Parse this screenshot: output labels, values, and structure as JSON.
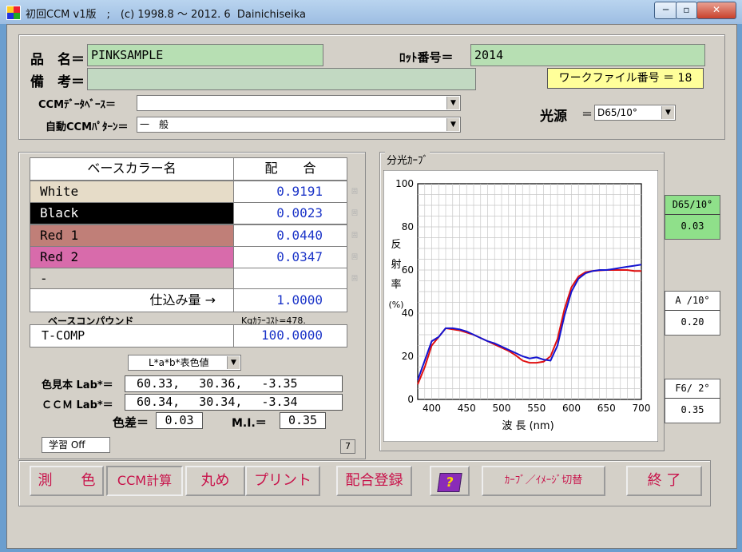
{
  "window": {
    "title": "初回CCM v1版　;　(c) 1998.8 ～ 2012. 6  Dainichiseika",
    "minimize": "─",
    "restore": "▫",
    "close": "✕"
  },
  "header": {
    "product_name_label": "品　名＝",
    "product_name_value": "PINKSAMPLE",
    "lot_label": "ﾛｯﾄ番号＝",
    "lot_value": "2014",
    "remarks_label": "備　考＝",
    "remarks_value": "",
    "workfile_label": "ワークファイル番号 ＝ 18",
    "ccm_db_label": "CCMﾃﾞｰﾀﾍﾞｰｽ＝",
    "ccm_db_value": "",
    "auto_pattern_label": "自動CCMﾊﾟﾀｰﾝ＝",
    "auto_pattern_value": "一　般",
    "light_source_label": "光源",
    "light_source_eq": "＝",
    "light_source_value": "D65/10°"
  },
  "recipe": {
    "col_base": "ベースカラー名",
    "col_ratio": "配　　合",
    "rows": [
      {
        "name": "White",
        "ratio": "0.9191",
        "bg": "#e6dcc8",
        "fg": "#000000"
      },
      {
        "name": "Black",
        "ratio": "0.0023",
        "bg": "#000000",
        "fg": "#ffffff"
      },
      {
        "name": "Red 1",
        "ratio": "0.0440",
        "bg": "#c07f78",
        "fg": "#000000"
      },
      {
        "name": "Red 2",
        "ratio": "0.0347",
        "bg": "#d86bab",
        "fg": "#000000"
      },
      {
        "name": "-",
        "ratio": "",
        "bg": "#d4d0c8",
        "fg": "#000000"
      }
    ],
    "lock_glyph": "固",
    "charge_label": "仕込み量 →",
    "charge_value": "1.0000",
    "base_compound_label": "ベースコンパウンド",
    "cost_label": "Kgｶﾗｰｺｽﾄ=478.",
    "compound_name": "T-COMP",
    "compound_value": "100.0000",
    "color_space_value": "L*a*b*表色値",
    "sample_label": "色見本 Lab*＝",
    "sample_value": "60.33,　 30.36,　 -3.35",
    "ccm_label": "ＣＣＭ Lab*＝",
    "ccm_value": "60.34,　 30.34,　 -3.34",
    "delta_label": "色差＝",
    "delta_value": "0.03",
    "mi_label": "M.I.＝",
    "mi_value": "0.35",
    "learning_label": "学習 Off",
    "page_no": "7"
  },
  "chart_panel_title": "分光ｶｰﾌﾞ",
  "chart_data": {
    "type": "line",
    "title": "",
    "xlabel": "波 長 (nm)",
    "ylabel": "反射率(%)",
    "ylabel_chars": [
      "反",
      "射",
      "率",
      "(%)"
    ],
    "xlim": [
      380,
      700
    ],
    "ylim": [
      0,
      100
    ],
    "xticks": [
      400,
      450,
      500,
      550,
      600,
      650,
      700
    ],
    "yticks": [
      0,
      20,
      40,
      60,
      80,
      100
    ],
    "grid": true,
    "series": [
      {
        "color": "#e01010",
        "x": [
          380,
          390,
          400,
          410,
          420,
          430,
          440,
          450,
          460,
          470,
          480,
          490,
          500,
          510,
          520,
          530,
          540,
          550,
          560,
          570,
          580,
          590,
          600,
          610,
          620,
          630,
          640,
          650,
          660,
          670,
          680,
          690,
          700
        ],
        "values": [
          7,
          15,
          25,
          29,
          33,
          32.5,
          32,
          31,
          30,
          28.5,
          27,
          25.5,
          24,
          22.5,
          20.5,
          18,
          17,
          17,
          17.5,
          20,
          28,
          42,
          52,
          57,
          59,
          59.5,
          59.8,
          60,
          60,
          60,
          60,
          59.5,
          59.5
        ]
      },
      {
        "color": "#1414d0",
        "x": [
          380,
          390,
          400,
          410,
          420,
          430,
          440,
          450,
          460,
          470,
          480,
          490,
          500,
          510,
          520,
          530,
          540,
          550,
          560,
          570,
          580,
          590,
          600,
          610,
          620,
          630,
          640,
          650,
          660,
          670,
          680,
          690,
          700
        ],
        "values": [
          9,
          18,
          27,
          29,
          33,
          33,
          32.5,
          31.5,
          30,
          28.5,
          27,
          26,
          24.5,
          23,
          21.5,
          20,
          19,
          19.5,
          18.5,
          18,
          25,
          39,
          50,
          56,
          58.5,
          59.5,
          60,
          60,
          60.5,
          61,
          61.5,
          62,
          62.5
        ]
      }
    ]
  },
  "illuminants": [
    {
      "name": "D65/10°",
      "value": "0.03",
      "active": true
    },
    {
      "name": "A /10°",
      "value": "0.20",
      "active": false
    },
    {
      "name": "F6/ 2°",
      "value": "0.35",
      "active": false
    }
  ],
  "buttons": {
    "measure": "測　　色",
    "ccm_calc": "CCM計算",
    "round": "丸め",
    "print": "プリント",
    "register": "配合登録",
    "help": "?",
    "toggle": "ｶｰﾌﾞ／ｲﾒｰｼﾞ切替",
    "exit": "終 了"
  }
}
